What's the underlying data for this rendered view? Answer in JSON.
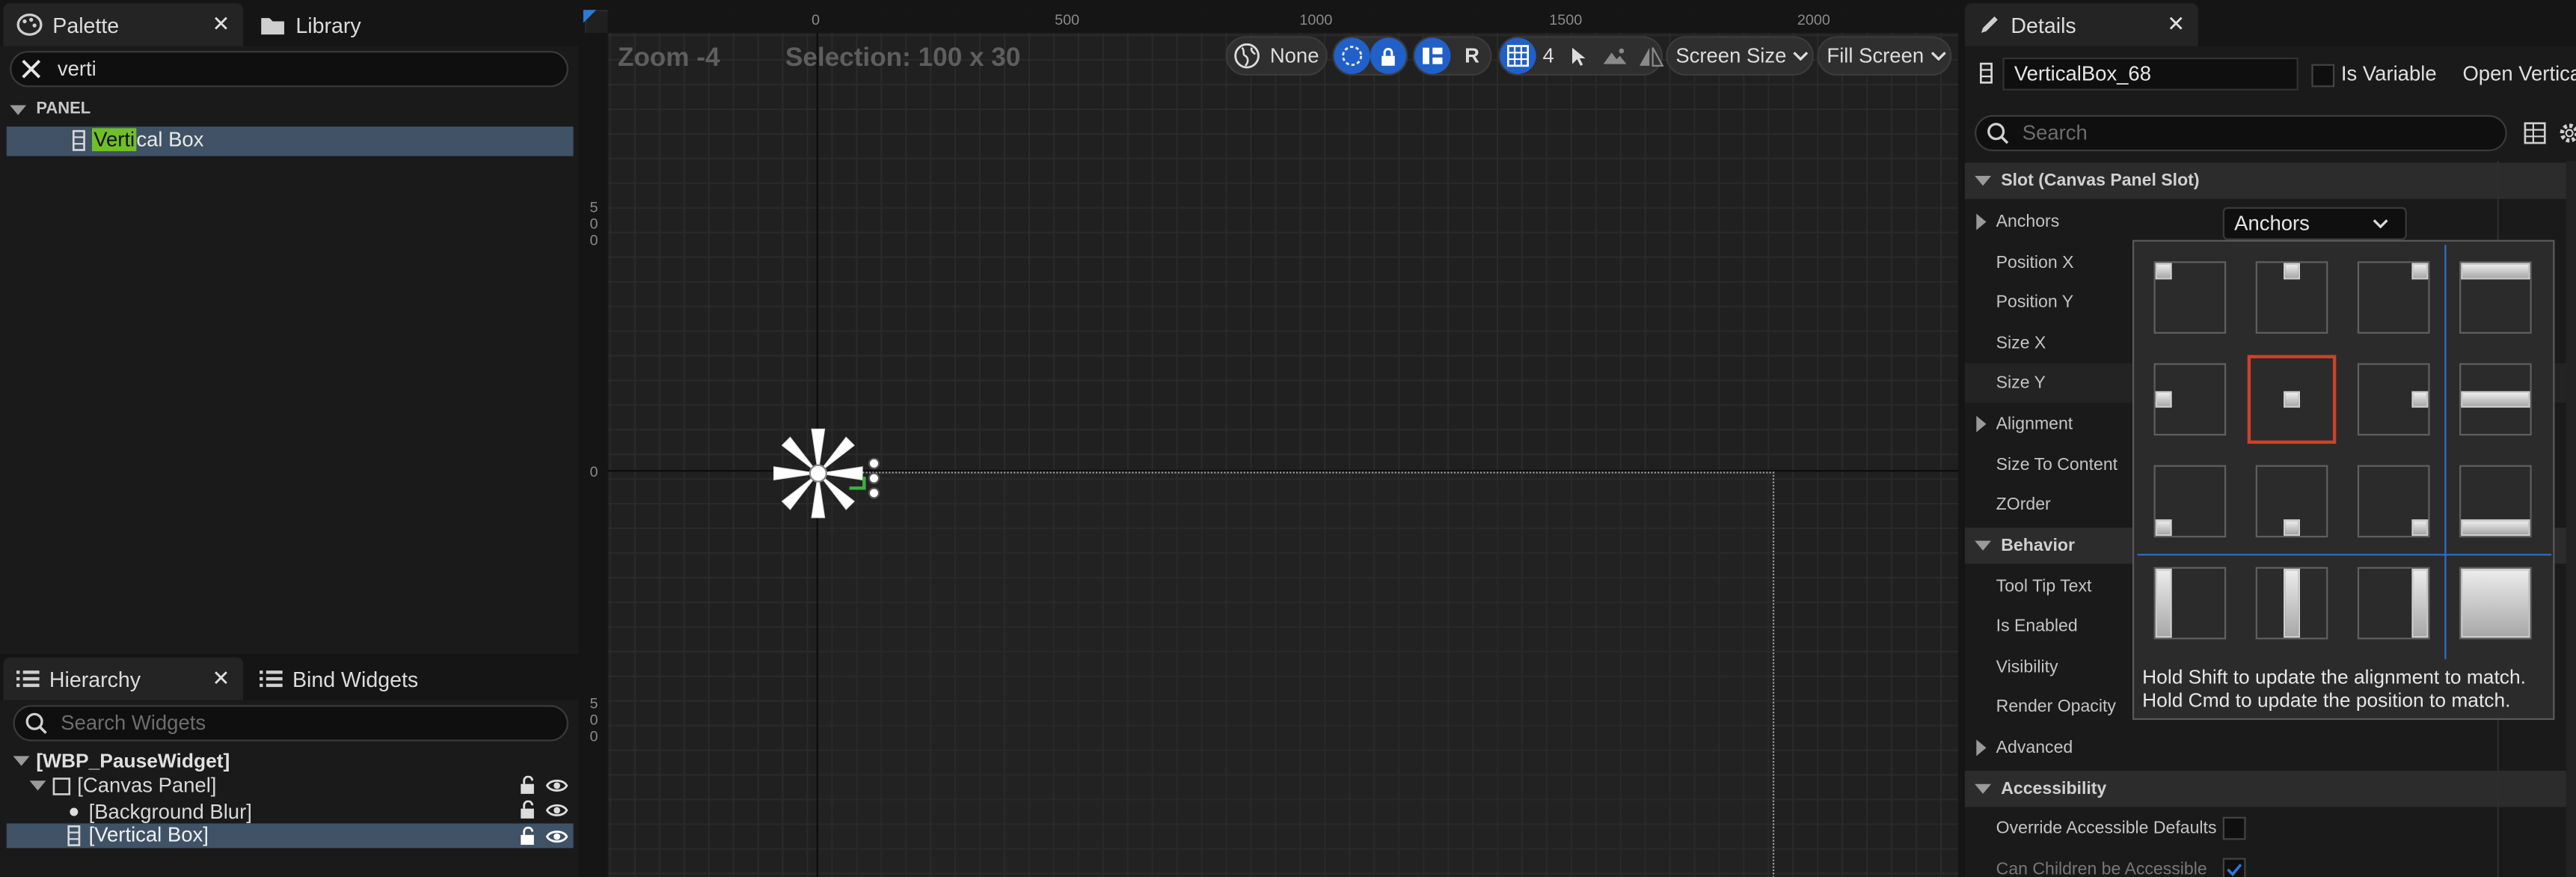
{
  "palette": {
    "tab_label": "Palette",
    "library_tab_label": "Library",
    "search_value": "verti",
    "section_label": "PANEL",
    "item_highlight": "Verti",
    "item_rest": "cal Box"
  },
  "hierarchy": {
    "tab_label": "Hierarchy",
    "bind_tab_label": "Bind Widgets",
    "search_placeholder": "Search Widgets",
    "root": "[WBP_PauseWidget]",
    "canvas": "[Canvas Panel]",
    "blur": "[Background Blur]",
    "vbox": "[Vertical Box]"
  },
  "viewport": {
    "zoom_label": "Zoom -4",
    "selection_label": "Selection: 100 x 30",
    "none_label": "None",
    "r_label": "R",
    "grid_value": "4",
    "screen_size_label": "Screen Size",
    "fill_screen_label": "Fill Screen",
    "ruler_top": [
      "0",
      "500",
      "1000",
      "1500",
      "2000"
    ],
    "ruler_left_a": [
      "5",
      "0",
      "0"
    ],
    "ruler_left_zero": "0",
    "ruler_left_b": [
      "5",
      "0",
      "0"
    ]
  },
  "details": {
    "tab_label": "Details",
    "widget_name": "VerticalBox_68",
    "is_variable_label": "Is Variable",
    "open_label": "Open Vertica",
    "search_placeholder": "Search",
    "slot_section": "Slot (Canvas Panel Slot)",
    "anchors_label": "Anchors",
    "anchors_dropdown": "Anchors",
    "rows": [
      "Position X",
      "Position Y",
      "Size X",
      "Size Y",
      "Alignment",
      "Size To Content",
      "ZOrder"
    ],
    "behavior_section": "Behavior",
    "behavior_rows": [
      "Tool Tip Text",
      "Is Enabled",
      "Visibility",
      "Render Opacity"
    ],
    "advanced_label": "Advanced",
    "accessibility_section": "Accessibility",
    "override_label": "Override Accessible Defaults",
    "children_label": "Can Children be Accessible",
    "tip_shift": "Hold Shift to update the alignment to match.",
    "tip_cmd": "Hold Cmd to update the position to match."
  },
  "colors": {
    "selection_blue": "#3f5266",
    "highlight_green": "#6fbf2a",
    "accent_blue": "#2160c8",
    "selected_anchor_red": "#d0402a"
  }
}
